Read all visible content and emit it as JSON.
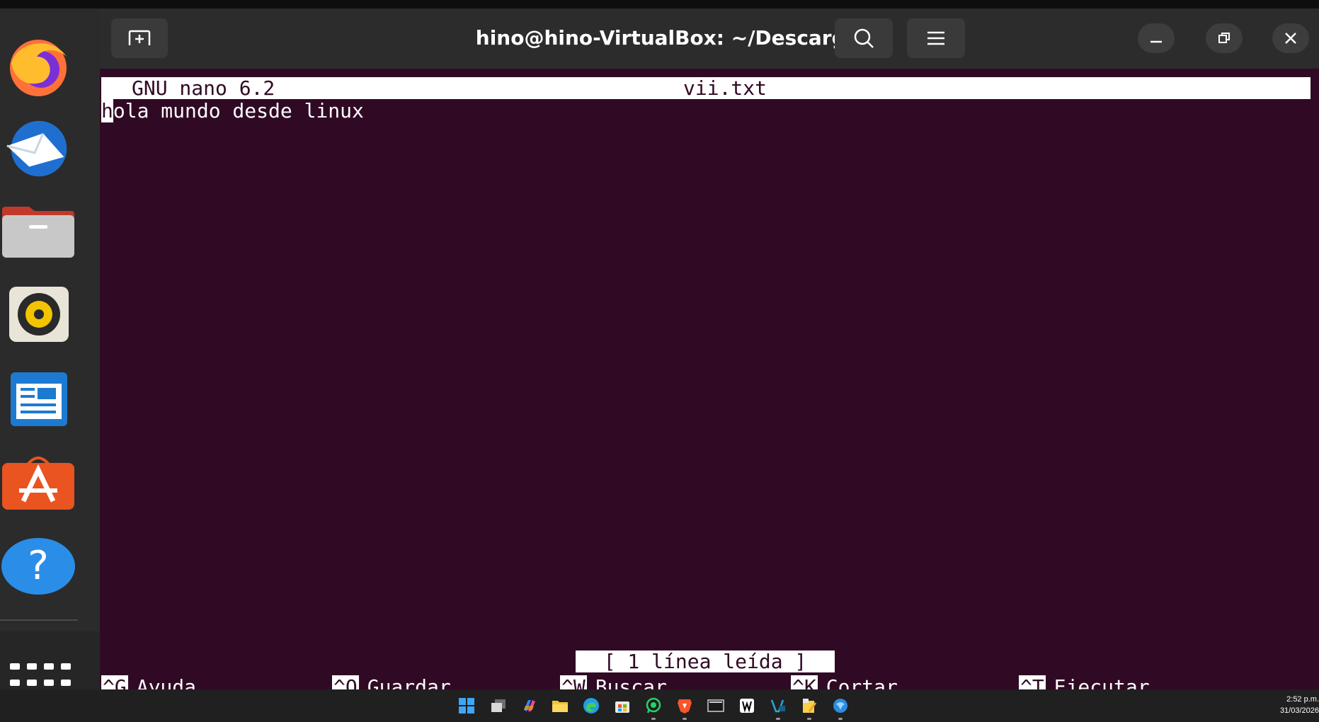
{
  "window": {
    "title": "hino@hino-VirtualBox: ~/Descargas"
  },
  "nano": {
    "version_label": "GNU nano 6.2",
    "filename": "vii.txt",
    "content_first_char": "h",
    "content_rest": "ola mundo desde linux",
    "status_message": "[ 1 línea leída ]",
    "shortcuts": [
      {
        "key": "^G",
        "label": "Ayuda"
      },
      {
        "key": "^O",
        "label": "Guardar"
      },
      {
        "key": "^W",
        "label": "Buscar"
      },
      {
        "key": "^K",
        "label": "Cortar"
      },
      {
        "key": "^T",
        "label": "Ejecutar"
      }
    ]
  },
  "dock": {
    "items": [
      "firefox-icon",
      "thunderbird-icon",
      "files-icon",
      "rhythmbox-icon",
      "libreoffice-writer-icon",
      "app-center-icon",
      "help-icon",
      "show-apps-icon"
    ]
  },
  "taskbar": {
    "icons": [
      "windows-start-icon",
      "task-view-icon",
      "copilot-icon",
      "file-explorer-icon",
      "edge-icon",
      "store-icon",
      "whatsapp-icon",
      "brave-icon",
      "terminal-icon",
      "notion-icon",
      "virtualbox-icon",
      "sticky-notes-icon",
      "browser-icon"
    ],
    "time": "2:52 p.m.",
    "date": "31/03/2026"
  },
  "colors": {
    "terminal_bg": "#300a24",
    "headerbar_bg": "#2c2c2c",
    "dock_bg": "#2b2b2b",
    "taskbar_bg": "#202020"
  }
}
